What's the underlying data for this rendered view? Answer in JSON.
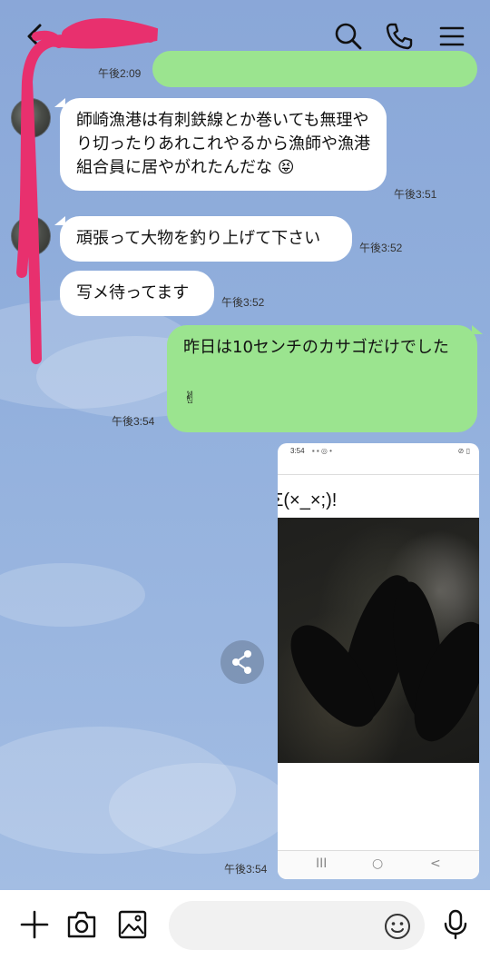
{
  "header": {
    "title": "",
    "icons": [
      "back-arrow-icon",
      "search-icon",
      "phone-icon",
      "menu-icon"
    ]
  },
  "messages": [
    {
      "side": "out",
      "text": "",
      "time": "午後2:09"
    },
    {
      "side": "in",
      "text": "師崎漁港は有刺鉄線とか巻いても無理やり切ったりあれこれやるから漁師や漁港組合員に居やがれたんだな",
      "emoji": "😝",
      "time": "午後3:51"
    },
    {
      "side": "in",
      "text": "頑張って大物を釣り上げて下さい",
      "time": "午後3:52"
    },
    {
      "side": "in",
      "text": "写メ待ってます",
      "time": "午後3:52"
    },
    {
      "side": "out",
      "text": "昨日は10センチのカサゴだけでした",
      "emoji": "✌",
      "time": "午後3:54"
    },
    {
      "side": "out",
      "type": "image",
      "time": "午後3:54"
    }
  ],
  "image_message": {
    "status_time": "3:54",
    "caption": "Σ(×_×;)!",
    "nav_buttons": [
      "III",
      "○",
      "<"
    ]
  },
  "input_bar": {
    "placeholder": "",
    "icons": [
      "plus-icon",
      "camera-icon",
      "image-icon",
      "emoji-icon",
      "microphone-icon"
    ]
  },
  "colors": {
    "background": "#8ba9d9",
    "outgoing_bubble": "#9be48f",
    "incoming_bubble": "#ffffff",
    "redaction": "#e8306e"
  }
}
